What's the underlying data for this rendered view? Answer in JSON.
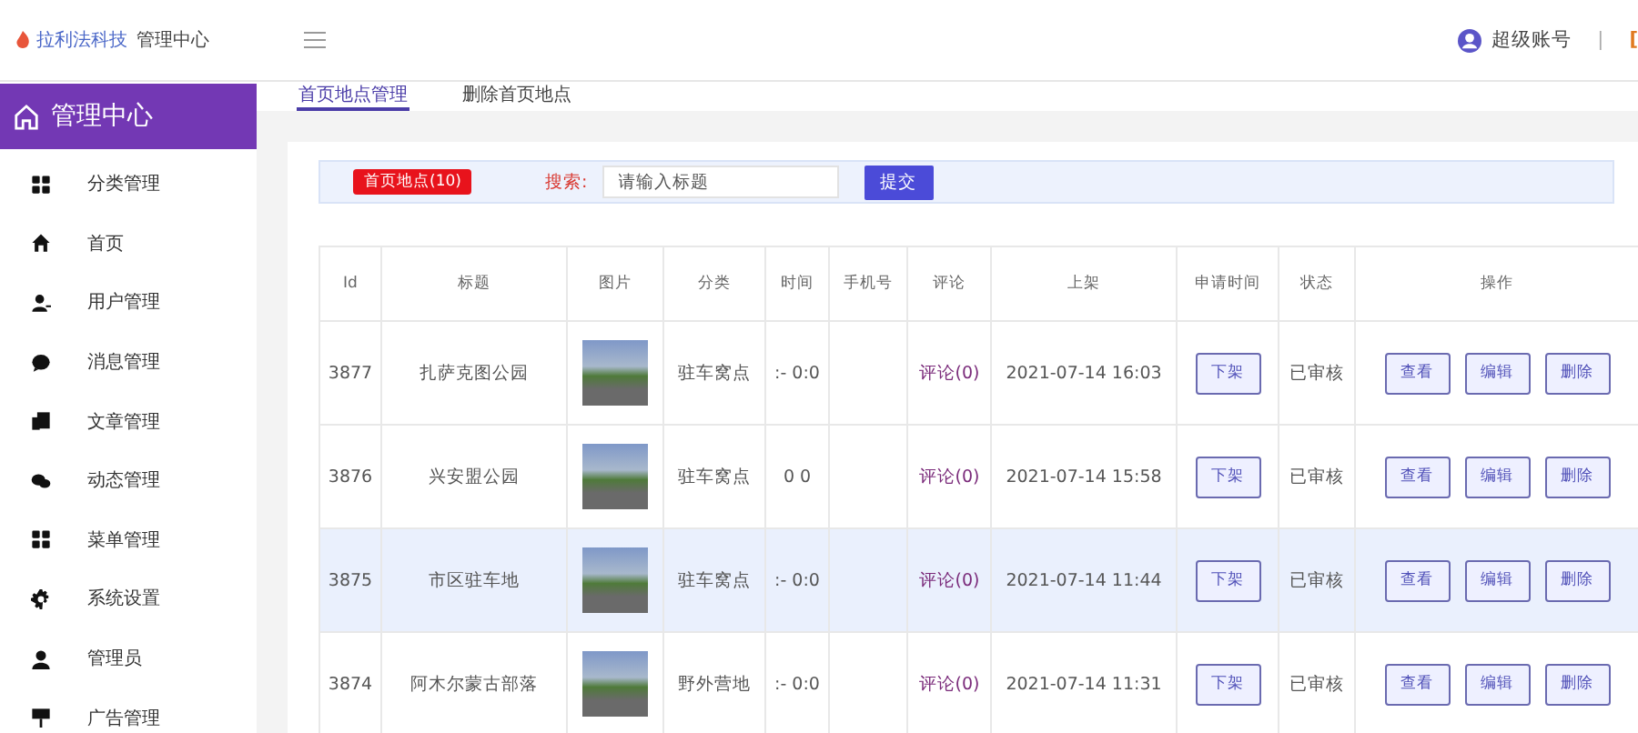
{
  "header": {
    "logo": "拉利法科技",
    "app_name": "管理中心",
    "user": "超级账号",
    "separator": "|",
    "cut_link": "["
  },
  "sidebar": {
    "title": "管理中心",
    "items": [
      {
        "label": "分类管理",
        "kind": "grid"
      },
      {
        "label": "首页",
        "kind": "home"
      },
      {
        "label": "用户管理",
        "kind": "useradd"
      },
      {
        "label": "消息管理",
        "kind": "chat"
      },
      {
        "label": "文章管理",
        "kind": "doc"
      },
      {
        "label": "动态管理",
        "kind": "chats"
      },
      {
        "label": "菜单管理",
        "kind": "grid"
      },
      {
        "label": "系统设置",
        "kind": "gear"
      },
      {
        "label": "管理员",
        "kind": "user"
      },
      {
        "label": "广告管理",
        "kind": "sign"
      }
    ]
  },
  "tabs": [
    {
      "label": "首页地点管理",
      "selected": true
    },
    {
      "label": "删除首页地点",
      "selected": false
    }
  ],
  "search": {
    "badge": "首页地点(10)",
    "label": "搜索:",
    "placeholder": "请输入标题",
    "button": "提交"
  },
  "table": {
    "columns": [
      "Id",
      "标题",
      "图片",
      "分类",
      "时间",
      "手机号",
      "评论",
      "上架",
      "申请时间",
      "状态",
      "操作"
    ],
    "rows": [
      {
        "id": "3877",
        "title": "扎萨克图公园",
        "category": "驻车窝点",
        "time": ":- 0:0",
        "comment": "评论(0)",
        "listed": "2021-07-14 16:03",
        "unlist": "下架",
        "status": "已审核",
        "actions": [
          "查看",
          "编辑",
          "删除"
        ],
        "selected": false
      },
      {
        "id": "3876",
        "title": "兴安盟公园",
        "category": "驻车窝点",
        "time": "0 0",
        "comment": "评论(0)",
        "listed": "2021-07-14 15:58",
        "unlist": "下架",
        "status": "已审核",
        "actions": [
          "查看",
          "编辑",
          "删除"
        ],
        "selected": false
      },
      {
        "id": "3875",
        "title": "市区驻车地",
        "category": "驻车窝点",
        "time": ":- 0:0",
        "comment": "评论(0)",
        "listed": "2021-07-14 11:44",
        "unlist": "下架",
        "status": "已审核",
        "actions": [
          "查看",
          "编辑",
          "删除"
        ],
        "selected": true
      },
      {
        "id": "3874",
        "title": "阿木尔蒙古部落",
        "category": "野外营地",
        "time": ":- 0:0",
        "comment": "评论(0)",
        "listed": "2021-07-14 11:31",
        "unlist": "下架",
        "status": "已审核",
        "actions": [
          "查看",
          "编辑",
          "删除"
        ],
        "selected": false
      }
    ]
  }
}
